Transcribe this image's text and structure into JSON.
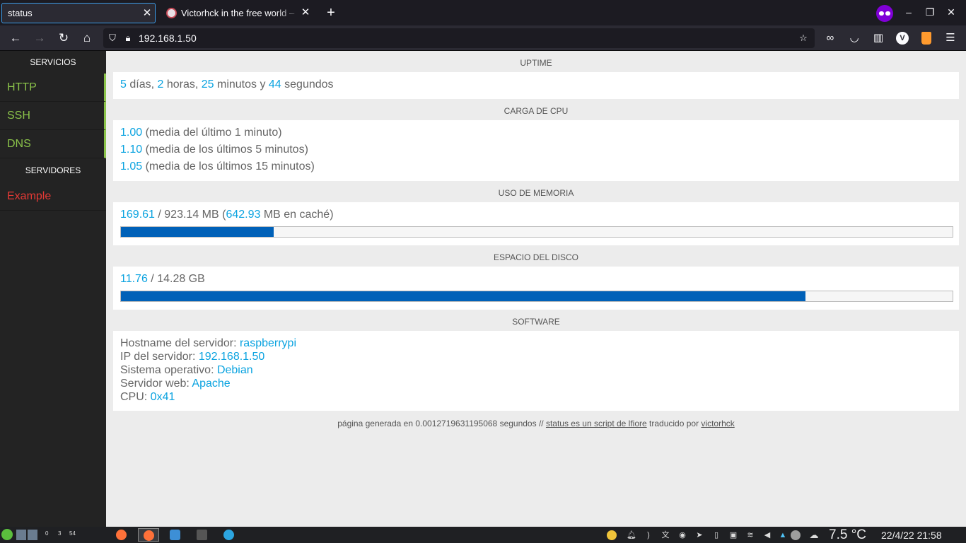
{
  "browser": {
    "tabs": [
      {
        "title": "status"
      },
      {
        "title": "Victorhck in the free world – "
      }
    ],
    "url": "192.168.1.50"
  },
  "sidebar": {
    "services_heading": "SERVICIOS",
    "services": [
      {
        "label": "HTTP",
        "status": "ok"
      },
      {
        "label": "SSH",
        "status": "ok"
      },
      {
        "label": "DNS",
        "status": "ok"
      }
    ],
    "servers_heading": "SERVIDORES",
    "servers": [
      {
        "label": "Example",
        "status": "down"
      }
    ]
  },
  "uptime": {
    "heading": "UPTIME",
    "days": "5",
    "days_label": " días, ",
    "hours": "2",
    "hours_label": " horas, ",
    "minutes": "25",
    "minutes_label": " minutos y ",
    "seconds": "44",
    "seconds_label": " segundos"
  },
  "cpu": {
    "heading": "CARGA DE CPU",
    "loads": [
      {
        "value": "1.00",
        "label": " (media del último 1 minuto)"
      },
      {
        "value": "1.10",
        "label": " (media de los últimos 5 minutos)"
      },
      {
        "value": "1.05",
        "label": " (media de los últimos 15 minutos)"
      }
    ]
  },
  "memory": {
    "heading": "USO DE MEMORIA",
    "used": "169.61",
    "total_text": " / 923.14 MB (",
    "cached": "642.93",
    "cached_text": " MB en caché)",
    "fill_fraction": 0.184
  },
  "disk": {
    "heading": "ESPACIO DEL DISCO",
    "used": "11.76",
    "total_text": " / 14.28 GB",
    "fill_fraction": 0.823
  },
  "software": {
    "heading": "SOFTWARE",
    "rows": [
      {
        "label": "Hostname del servidor: ",
        "value": "raspberrypi"
      },
      {
        "label": "IP del servidor: ",
        "value": "192.168.1.50"
      },
      {
        "label": "Sistema operativo: ",
        "value": "Debian"
      },
      {
        "label": "Servidor web: ",
        "value": "Apache"
      },
      {
        "label": "CPU: ",
        "value": "0x41"
      }
    ]
  },
  "footer": {
    "text": "página generada en 0.0012719631195068 segundos // ",
    "link1": "status es un script de lfiore",
    "middle": " traducido por ",
    "link2": "victorhck"
  },
  "taskbar": {
    "counter": [
      "0",
      "3",
      "54"
    ],
    "temperature": "7.5 °C",
    "datetime": "22/4/22 21:58"
  },
  "colors": {
    "accent_blue": "#0aa3e0",
    "ok_green": "#8bc34a",
    "down_red": "#e53935",
    "bar_fill": "#0061b8"
  }
}
